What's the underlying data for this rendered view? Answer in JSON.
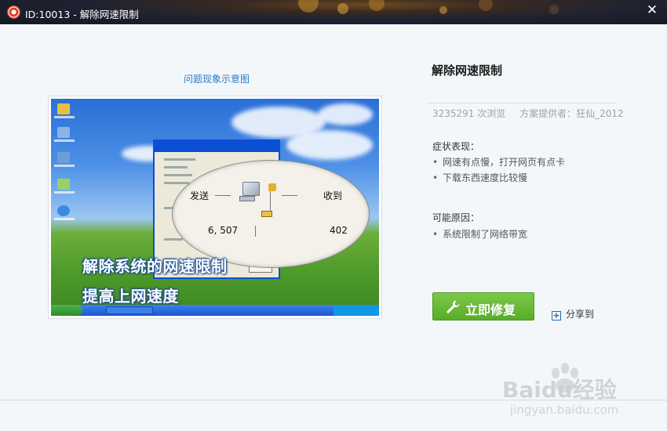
{
  "window": {
    "title": "ID:10013 - 解除网速限制",
    "close_glyph": "✕"
  },
  "illustration": {
    "caption": "问题现象示意图",
    "send_label": "发送",
    "recv_label": "收到",
    "sent_count": "6, 507",
    "recv_count": "402",
    "overlay_line1": "解除系统的网速限制",
    "overlay_line2": "提高上网速度"
  },
  "issue": {
    "title": "解除网速限制",
    "views": "3235291 次浏览",
    "provider": "方案提供者：狂仙_2012",
    "symptoms_heading": "症状表现：",
    "symptoms": [
      "网速有点慢，打开网页有点卡",
      "下载东西速度比较慢"
    ],
    "causes_heading": "可能原因：",
    "causes": [
      "系统限制了网络带宽"
    ]
  },
  "actions": {
    "fix_label": "立即修复",
    "share_label": "分享到"
  },
  "watermark": {
    "brand": "Baidu经验",
    "site": "jingyan.baidu.com"
  },
  "colors": {
    "accent_green": "#58ac2a",
    "link_blue": "#2a7cc7"
  }
}
